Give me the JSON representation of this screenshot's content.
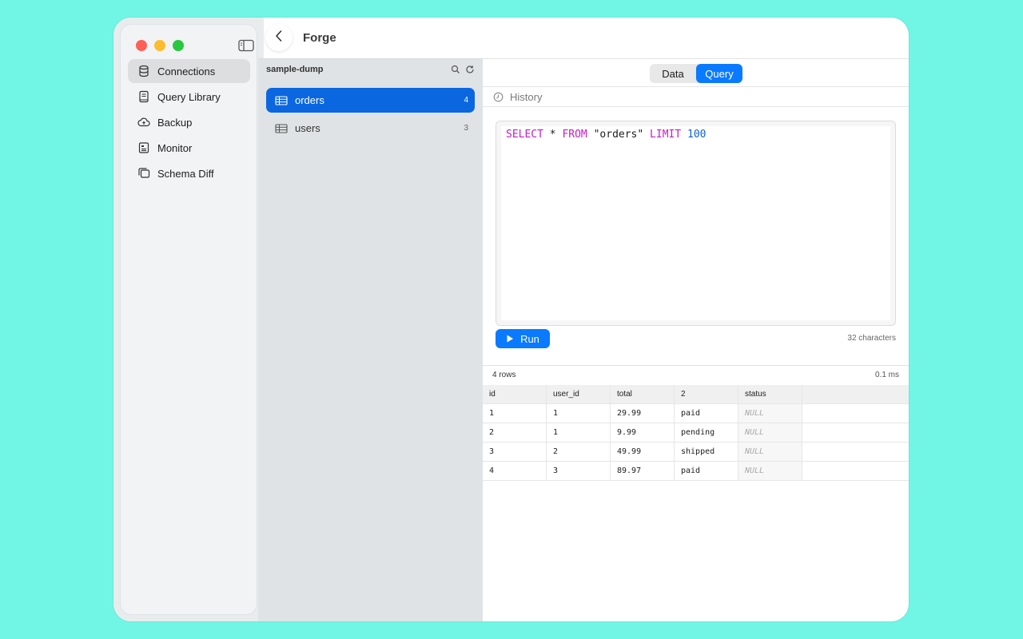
{
  "app": {
    "title": "Forge"
  },
  "sidebar": {
    "items": [
      {
        "label": "Connections",
        "icon": "database-icon",
        "active": true
      },
      {
        "label": "Query Library",
        "icon": "book-icon",
        "active": false
      },
      {
        "label": "Backup",
        "icon": "cloud-icon",
        "active": false
      },
      {
        "label": "Monitor",
        "icon": "monitor-icon",
        "active": false
      },
      {
        "label": "Schema Diff",
        "icon": "schema-diff-icon",
        "active": false
      }
    ]
  },
  "tables_panel": {
    "database_name": "sample-dump",
    "tables": [
      {
        "name": "orders",
        "count": "4",
        "active": true
      },
      {
        "name": "users",
        "count": "3",
        "active": false
      }
    ]
  },
  "tabs": {
    "data": "Data",
    "query": "Query",
    "selected": "Query"
  },
  "history": {
    "label": "History"
  },
  "editor": {
    "tokens": [
      "SELECT",
      "*",
      "FROM",
      "\"orders\"",
      "LIMIT",
      "100"
    ]
  },
  "run": {
    "label": "Run"
  },
  "char_count": "32 characters",
  "result": {
    "rows_label": "4 rows",
    "time_label": "0.1 ms",
    "columns": [
      "id",
      "user_id",
      "total",
      "2",
      "status"
    ],
    "rows": [
      [
        "1",
        "1",
        "29.99",
        "paid",
        "NULL"
      ],
      [
        "2",
        "1",
        "9.99",
        "pending",
        "NULL"
      ],
      [
        "3",
        "2",
        "49.99",
        "shipped",
        "NULL"
      ],
      [
        "4",
        "3",
        "89.97",
        "paid",
        "NULL"
      ]
    ]
  },
  "colors": {
    "accent": "#0a7aff",
    "selection": "#0a67e0",
    "background": "#71f6e5",
    "keyword": "#c71ac9",
    "number": "#0a62d9"
  }
}
